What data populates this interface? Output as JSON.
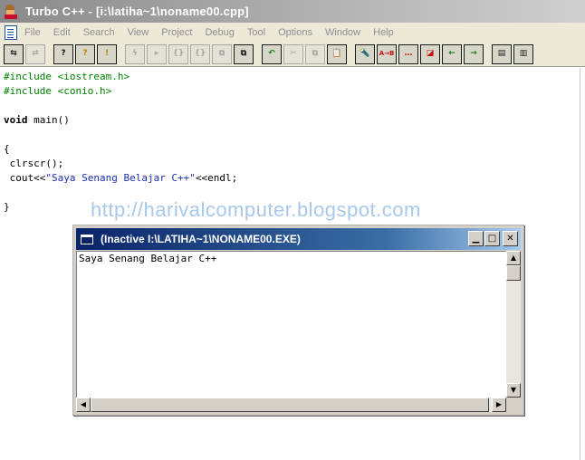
{
  "window": {
    "title": "Turbo C++ - [i:\\latiha~1\\noname00.cpp]"
  },
  "menu": {
    "items": [
      "File",
      "Edit",
      "Search",
      "View",
      "Project",
      "Debug",
      "Tool",
      "Options",
      "Window",
      "Help"
    ]
  },
  "toolbar": {
    "buttons": [
      {
        "icon": "open-project-icon",
        "glyph": "⇆",
        "enabled": true
      },
      {
        "icon": "save-all-icon",
        "glyph": "⇄",
        "enabled": false
      },
      {
        "icon": "binary-search-icon",
        "glyph": "?",
        "enabled": true
      },
      {
        "icon": "browse-symbol-icon",
        "glyph": "?",
        "enabled": true
      },
      {
        "icon": "find-in-files-icon",
        "glyph": "!",
        "enabled": true
      },
      {
        "icon": "make-icon",
        "glyph": "ϟ",
        "enabled": false
      },
      {
        "icon": "step-over-icon",
        "glyph": "▸",
        "enabled": false
      },
      {
        "icon": "trace-into-icon",
        "glyph": "{}",
        "enabled": false
      },
      {
        "icon": "run-icon",
        "glyph": "{}",
        "enabled": false
      },
      {
        "icon": "compile-icon",
        "glyph": "⧉",
        "enabled": false
      },
      {
        "icon": "build-all-icon",
        "glyph": "⧉",
        "enabled": true
      },
      {
        "icon": "undo-icon",
        "glyph": "↶",
        "enabled": true
      },
      {
        "icon": "cut-icon",
        "glyph": "✂",
        "enabled": false
      },
      {
        "icon": "copy-icon",
        "glyph": "⧉",
        "enabled": false
      },
      {
        "icon": "paste-icon",
        "glyph": "📋",
        "enabled": true
      },
      {
        "icon": "search-icon",
        "glyph": "🔦",
        "enabled": true
      },
      {
        "icon": "replace-icon",
        "glyph": "A→B",
        "enabled": true
      },
      {
        "icon": "search-again-icon",
        "glyph": "…",
        "enabled": true
      },
      {
        "icon": "find-function-icon",
        "glyph": "◪",
        "enabled": true
      },
      {
        "icon": "go-back-icon",
        "glyph": "←",
        "enabled": true
      },
      {
        "icon": "go-forward-icon",
        "glyph": "→",
        "enabled": true
      },
      {
        "icon": "dialog-view-icon",
        "glyph": "▤",
        "enabled": true
      },
      {
        "icon": "tile-windows-icon",
        "glyph": "▥",
        "enabled": true
      }
    ]
  },
  "editor": {
    "lines": [
      "#include <iostream.h>",
      "#include <conio.h>",
      "",
      "void main()",
      "",
      "{",
      " clrscr();",
      " cout<<\"Saya Senang Belajar C++\"<<endl;",
      "",
      "}"
    ]
  },
  "watermark": "http://harivalcomputer.blogspot.com",
  "console": {
    "title": "(Inactive I:\\LATIHA~1\\NONAME00.EXE)",
    "output": "Saya Senang Belajar C++"
  },
  "colors": {
    "preprocessor": "#008000",
    "string": "#1a2fb0",
    "console_title": "#0a246a"
  }
}
